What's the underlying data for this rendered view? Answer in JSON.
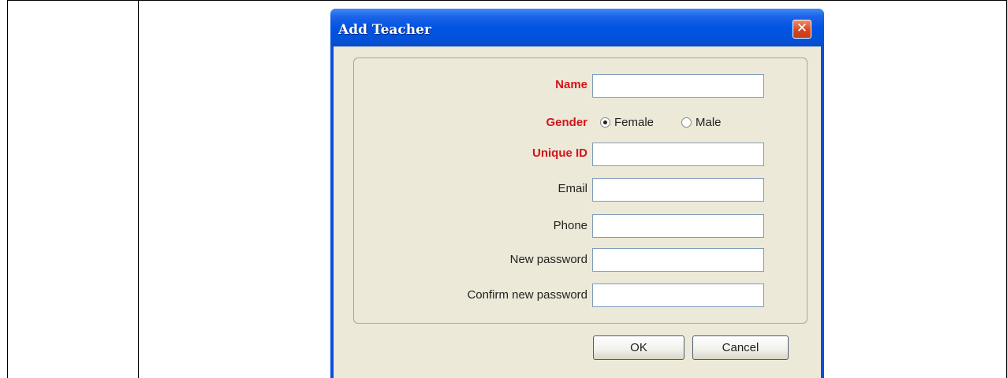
{
  "dialog": {
    "title": "Add Teacher",
    "close_symbol": "✕",
    "close_icon": "close-icon"
  },
  "form": {
    "name_label": "Name",
    "gender_label": "Gender",
    "gender_options": [
      "Female",
      "Male"
    ],
    "gender_selected": "Female",
    "unique_id_label": "Unique ID",
    "email_label": "Email",
    "phone_label": "Phone",
    "new_password_label": "New password",
    "confirm_password_label": "Confirm new password",
    "name_value": "",
    "unique_id_value": "",
    "email_value": "",
    "phone_value": "",
    "new_password_value": "",
    "confirm_password_value": ""
  },
  "buttons": {
    "ok_label": "OK",
    "cancel_label": "Cancel"
  },
  "colors": {
    "required_label": "#d2141c",
    "titlebar": "#0054e3",
    "dialog_body": "#ece9d8"
  }
}
